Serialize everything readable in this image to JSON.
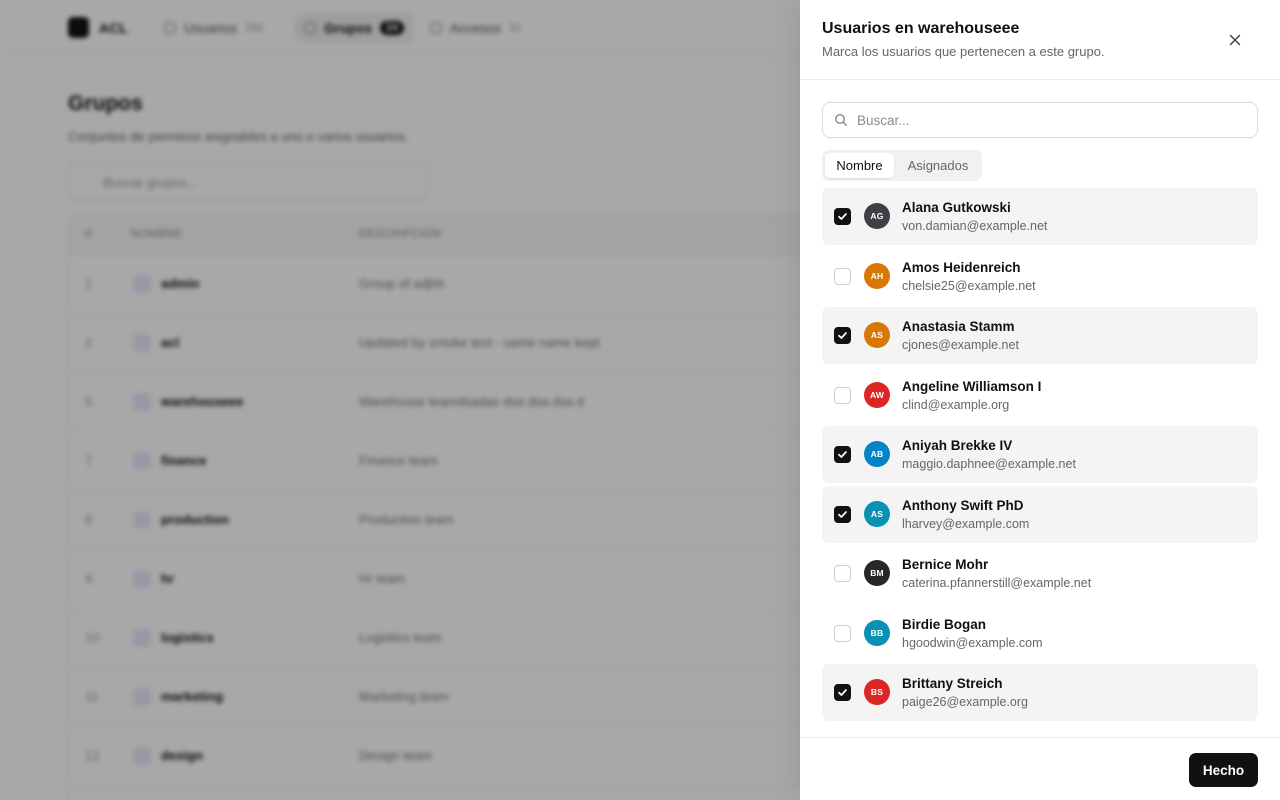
{
  "app": {
    "brand": "ACL",
    "nav": [
      {
        "label": "Usuarios",
        "count": "281",
        "icon": "user-icon"
      },
      {
        "label": "Grupos",
        "count": "24",
        "icon": "shield-icon"
      },
      {
        "label": "Accesos",
        "count": "31",
        "icon": "key-icon"
      }
    ],
    "page": {
      "title": "Grupos",
      "subtitle": "Conjuntos de permisos asignables a uno o varios usuarios.",
      "search_placeholder": "Buscar grupos..."
    },
    "table": {
      "headers": [
        "#",
        "NOMBRE",
        "DESCRIPCIÓN"
      ],
      "rows": [
        {
          "num": "1",
          "name": "admin",
          "desc": "Group of adjhh"
        },
        {
          "num": "2",
          "name": "acl",
          "desc": "Updated by smoke test - same name kept"
        },
        {
          "num": "5",
          "name": "warehouseee",
          "desc": "Warehouse teamdsadas dsa dsa dsa d"
        },
        {
          "num": "7",
          "name": "finance",
          "desc": "Finance team"
        },
        {
          "num": "8",
          "name": "production",
          "desc": "Production team"
        },
        {
          "num": "9",
          "name": "hr",
          "desc": "Hr team"
        },
        {
          "num": "10",
          "name": "logistics",
          "desc": "Logistics team"
        },
        {
          "num": "11",
          "name": "marketing",
          "desc": "Marketing team"
        },
        {
          "num": "12",
          "name": "design",
          "desc": "Design team"
        }
      ]
    }
  },
  "drawer": {
    "title": "Usuarios en warehouseee",
    "description": "Marca los usuarios que pertenecen a este grupo.",
    "search_placeholder": "Buscar...",
    "tabs": [
      {
        "label": "Nombre",
        "active": true
      },
      {
        "label": "Asignados",
        "active": false
      }
    ],
    "users": [
      {
        "initials": "AG",
        "name": "Alana Gutkowski",
        "email": "von.damian@example.net",
        "checked": true,
        "color": "#3f3f46"
      },
      {
        "initials": "AH",
        "name": "Amos Heidenreich",
        "email": "chelsie25@example.net",
        "checked": false,
        "color": "#d97706"
      },
      {
        "initials": "AS",
        "name": "Anastasia Stamm",
        "email": "cjones@example.net",
        "checked": true,
        "color": "#d97706"
      },
      {
        "initials": "AW",
        "name": "Angeline Williamson I",
        "email": "clind@example.org",
        "checked": false,
        "color": "#dc2626"
      },
      {
        "initials": "AB",
        "name": "Aniyah Brekke IV",
        "email": "maggio.daphnee@example.net",
        "checked": true,
        "color": "#0284c7"
      },
      {
        "initials": "AS",
        "name": "Anthony Swift PhD",
        "email": "lharvey@example.com",
        "checked": true,
        "color": "#0891b2"
      },
      {
        "initials": "BM",
        "name": "Bernice Mohr",
        "email": "caterina.pfannerstill@example.net",
        "checked": false,
        "color": "#27272a"
      },
      {
        "initials": "BB",
        "name": "Birdie Bogan",
        "email": "hgoodwin@example.com",
        "checked": false,
        "color": "#0891b2"
      },
      {
        "initials": "BS",
        "name": "Brittany Streich",
        "email": "paige26@example.org",
        "checked": true,
        "color": "#dc2626"
      }
    ],
    "done_label": "Hecho"
  }
}
